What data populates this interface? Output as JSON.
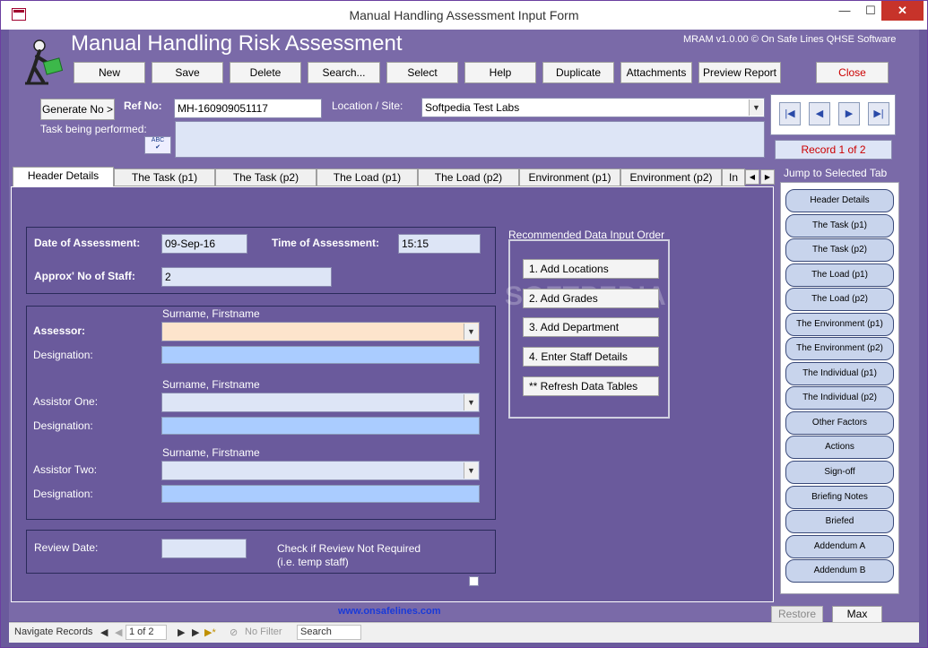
{
  "window": {
    "title": "Manual Handling Assessment Input Form",
    "min": "—",
    "max": "☐",
    "close": "✕"
  },
  "header": {
    "heading": "Manual Handling Risk Assessment",
    "version": "MRAM v1.0.00 © On Safe Lines QHSE Software"
  },
  "toolbar": {
    "new": "New",
    "save": "Save",
    "delete": "Delete",
    "search": "Search...",
    "select": "Select",
    "help": "Help",
    "duplicate": "Duplicate",
    "attachments": "Attachments",
    "preview_report": "Preview Report",
    "close": "Close"
  },
  "record": {
    "generate_no": "Generate No >",
    "ref_no_label": "Ref No:",
    "ref_no_value": "MH-160909051117",
    "location_label": "Location / Site:",
    "location_value": "Softpedia Test Labs",
    "task_label": "Task being performed:",
    "task_value": "",
    "spell_icon_text": "ABC",
    "counter": "Record 1 of 2"
  },
  "nav": {
    "first": "|◀",
    "prev": "◀",
    "next": "▶",
    "last": "▶|"
  },
  "tabs": [
    "Header Details",
    "The Task (p1)",
    "The Task (p2)",
    "The Load (p1)",
    "The Load (p2)",
    "Environment (p1)",
    "Environment (p2)",
    "In"
  ],
  "tab_scroll": {
    "left": "◀",
    "right": "▶"
  },
  "form": {
    "date_label": "Date of Assessment:",
    "date_value": "09-Sep-16",
    "time_label": "Time of Assessment:",
    "time_value": "15:15",
    "staff_label": "Approx' No of Staff:",
    "staff_value": "2",
    "name_hint": "Surname, Firstname",
    "assessor_label": "Assessor:",
    "designation_label": "Designation:",
    "assistor_one_label": "Assistor One:",
    "assistor_two_label": "Assistor Two:",
    "review_date_label": "Review Date:",
    "review_date_value": "",
    "review_check_label_1": "Check if Review Not Required",
    "review_check_label_2": "(i.e. temp staff)"
  },
  "input_order": {
    "heading": "Recommended Data Input Order",
    "buttons": [
      "1. Add Locations",
      "2. Add Grades",
      "3. Add Department",
      "4. Enter Staff Details",
      "** Refresh Data Tables"
    ]
  },
  "watermark": "SOFTPEDIA",
  "site_link": "www.onsafelines.com",
  "jump": {
    "heading": "Jump to Selected Tab",
    "items": [
      "Header Details",
      "The Task (p1)",
      "The Task (p2)",
      "The Load (p1)",
      "The Load (p2)",
      "The Environment (p1)",
      "The Environment (p2)",
      "The Individual (p1)",
      "The Individual (p2)",
      "Other Factors",
      "Actions",
      "Sign-off",
      "Briefing Notes",
      "Briefed",
      "Addendum A",
      "Addendum B"
    ]
  },
  "bottom": {
    "restore": "Restore",
    "max": "Max"
  },
  "statusbar": {
    "navigate": "Navigate Records",
    "first": "◀",
    "prev": "◀",
    "page": "1 of 2",
    "next": "▶",
    "last": "▶",
    "new": "▶*",
    "filter": "No Filter",
    "search": "Search"
  },
  "colors": {
    "form_bg": "#6a5a9c",
    "field_bg": "#dde5f6",
    "assessor_bg": "#fde4cc",
    "designation_bg": "#aaccff",
    "close_text": "#cc0000"
  }
}
